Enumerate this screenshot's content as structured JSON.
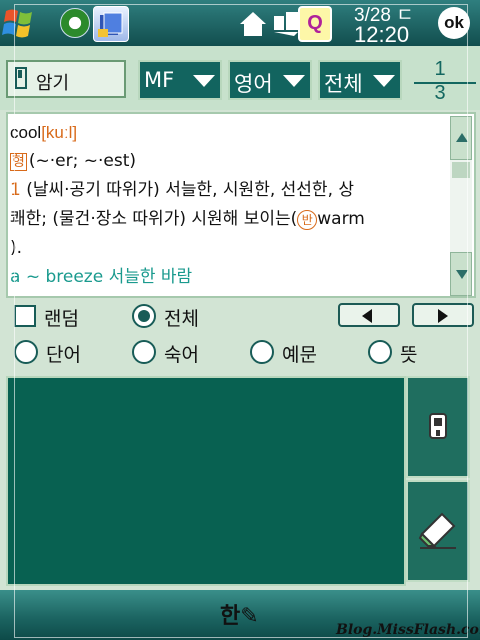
{
  "status_bar": {
    "date": "3/28 ㄷ",
    "time": "12:20",
    "ok_label": "ok",
    "icons": [
      "windows-start-icon",
      "sync-icon",
      "dictionary-book-icon",
      "home-icon",
      "network-icon",
      "q-notification-icon"
    ]
  },
  "toolbar": {
    "memorize_label": "암기",
    "font_dropdown": "MF",
    "language_dropdown": "영어",
    "range_dropdown": "전체",
    "page_current": "1",
    "page_total": "3"
  },
  "entry": {
    "headword": "cool",
    "pronunciation": "[kuːl]",
    "pos_badge": "형",
    "inflection": "(~·er; ~·est)",
    "sense_number": "1",
    "sense_line1": " (날씨·공기 따위가) 서늘한, 시원한, 선선한, 상",
    "sense_line2": "쾌한; (물건·장소 따위가) 시원해 보이는(",
    "antonym_badge": "반",
    "antonym_word": "warm",
    "sense_line3": ").",
    "example": "a ~ breeze 서늘한 바람"
  },
  "options": {
    "random_label": "랜덤",
    "all_label": "전체",
    "word_label": "단어",
    "idiom_label": "숙어",
    "example_label": "예문",
    "meaning_label": "뜻"
  },
  "bottom": {
    "ime_label": "한",
    "watermark": "Blog.MissFlash.com"
  },
  "colors": {
    "accent_dark": "#12645f",
    "panel": "#c7e1cc",
    "memo_bg": "#086151",
    "pronunciation": "#d86a1a",
    "example_text": "#1a9a8e"
  }
}
